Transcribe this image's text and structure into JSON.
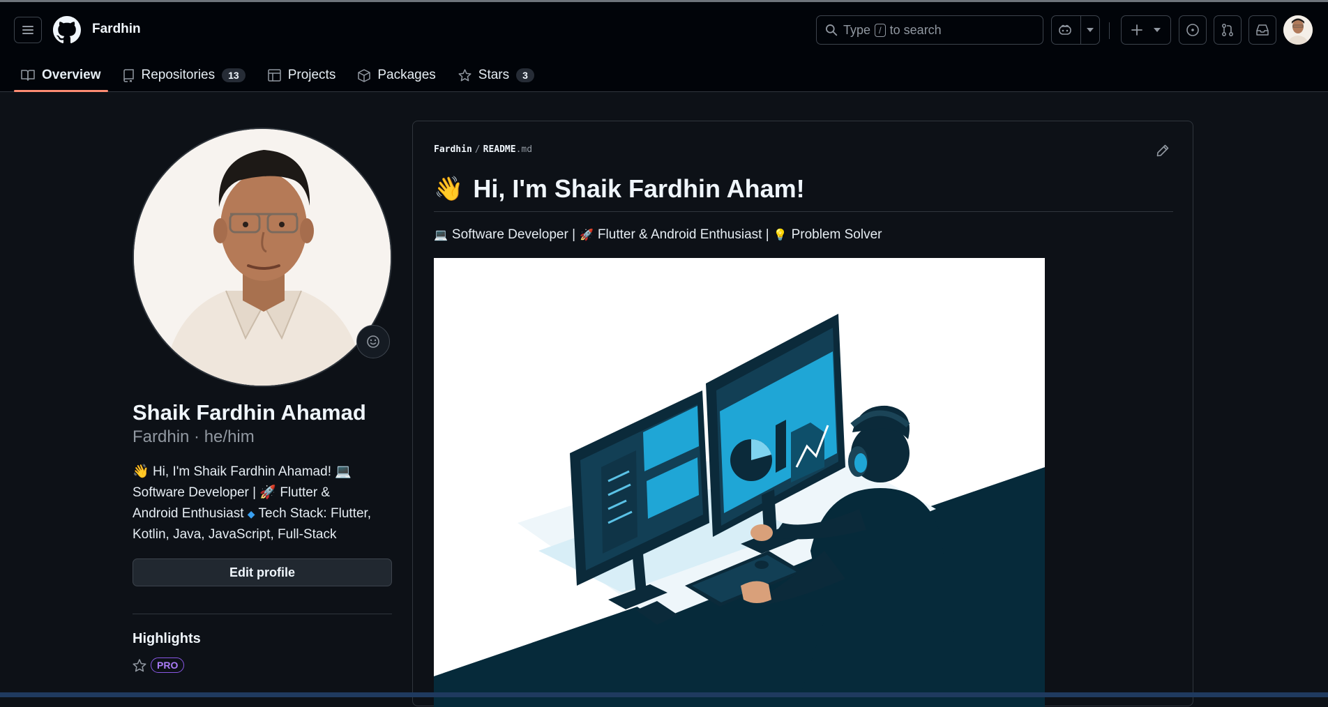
{
  "header": {
    "username": "Fardhin",
    "search": {
      "prefix": "Type",
      "key": "/",
      "suffix": "to search"
    }
  },
  "tabs": [
    {
      "label": "Overview",
      "active": true,
      "icon": "book-icon"
    },
    {
      "label": "Repositories",
      "count": "13",
      "icon": "repo-icon"
    },
    {
      "label": "Projects",
      "icon": "table-icon"
    },
    {
      "label": "Packages",
      "icon": "package-icon"
    },
    {
      "label": "Stars",
      "count": "3",
      "icon": "star-icon"
    }
  ],
  "profile": {
    "full_name": "Shaik Fardhin Ahamad",
    "login_line": "Fardhin · he/him",
    "bio": {
      "line1": "Hi, I'm Shaik Fardhin Ahamad!",
      "line2a": "Software Developer |",
      "line2b": "Flutter &",
      "line3a": "Android Enthusiast",
      "line3b": "Tech Stack: Flutter,",
      "line4": "Kotlin, Java, JavaScript, Full-Stack"
    },
    "edit_label": "Edit profile",
    "highlights_title": "Highlights",
    "pro_badge": "PRO"
  },
  "readme": {
    "owner": "Fardhin",
    "file": "README",
    "ext": ".md",
    "heading": "Hi, I'm Shaik Fardhin Aham!",
    "tag1": "Software Developer |",
    "tag2": "Flutter & Android Enthusiast |",
    "tag3": "Problem Solver"
  },
  "colors": {
    "accent_tab": "#fd8c73",
    "pro": "#ab7df8",
    "illustration_blue": "#1fa6d6",
    "illustration_dark": "#0b2a3a"
  }
}
